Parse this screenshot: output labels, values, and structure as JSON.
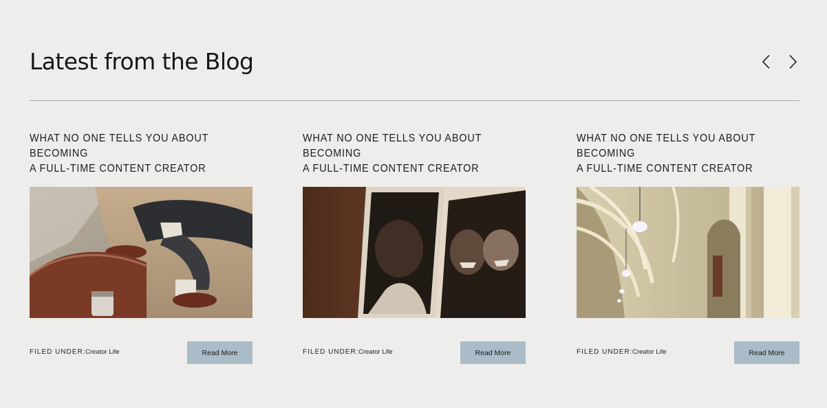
{
  "section": {
    "title": "Latest from the Blog",
    "prev_icon": "chevron-left-icon",
    "next_icon": "chevron-right-icon"
  },
  "posts": [
    {
      "title_line1": "WHAT NO ONE TELLS YOU ABOUT BECOMING",
      "title_line2": "A FULL-TIME CONTENT CREATOR",
      "filed_label": "FILED UNDER:",
      "category": "Creator Life",
      "read_more": "Read More"
    },
    {
      "title_line1": "WHAT NO ONE TELLS YOU ABOUT BECOMING",
      "title_line2": "A FULL-TIME CONTENT CREATOR",
      "filed_label": "FILED UNDER:",
      "category": "Creator Life",
      "read_more": "Read More"
    },
    {
      "title_line1": "WHAT NO ONE TELLS YOU ABOUT BECOMING",
      "title_line2": "A FULL-TIME CONTENT CREATOR",
      "filed_label": "FILED UNDER:",
      "category": "Creator Life",
      "read_more": "Read More"
    }
  ],
  "colors": {
    "background": "#efedeb",
    "button": "#a9bcc8",
    "divider": "#a7a7a7"
  }
}
